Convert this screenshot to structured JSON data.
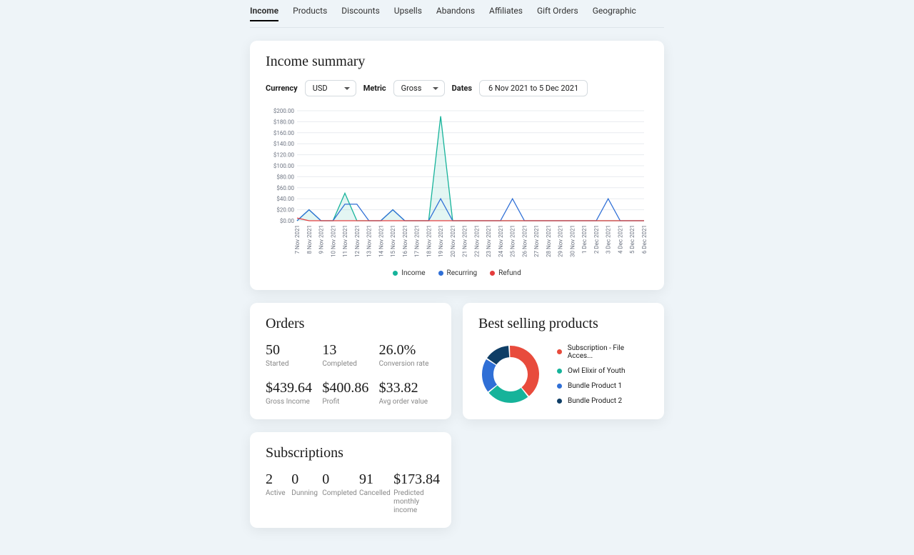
{
  "tabs": [
    "Income",
    "Products",
    "Discounts",
    "Upsells",
    "Abandons",
    "Affiliates",
    "Gift Orders",
    "Geographic"
  ],
  "active_tab_index": 0,
  "income_summary": {
    "title": "Income summary",
    "currency_label": "Currency",
    "currency_value": "USD",
    "metric_label": "Metric",
    "metric_value": "Gross",
    "dates_label": "Dates",
    "dates_value": "6 Nov 2021 to 5 Dec 2021",
    "legend": {
      "income": "Income",
      "recurring": "Recurring",
      "refund": "Refund"
    }
  },
  "chart_data": {
    "type": "line",
    "xlabel": "",
    "ylabel": "",
    "ylim": [
      0,
      200
    ],
    "ytick_labels": [
      "$0.00",
      "$20.00",
      "$40.00",
      "$60.00",
      "$80.00",
      "$100.00",
      "$120.00",
      "$140.00",
      "$160.00",
      "$180.00",
      "$200.00"
    ],
    "categories": [
      "7 Nov 2021",
      "8 Nov 2021",
      "9 Nov 2021",
      "10 Nov 2021",
      "11 Nov 2021",
      "12 Nov 2021",
      "13 Nov 2021",
      "14 Nov 2021",
      "15 Nov 2021",
      "16 Nov 2021",
      "17 Nov 2021",
      "18 Nov 2021",
      "19 Nov 2021",
      "20 Nov 2021",
      "21 Nov 2021",
      "22 Nov 2021",
      "23 Nov 2021",
      "24 Nov 2021",
      "25 Nov 2021",
      "26 Nov 2021",
      "27 Nov 2021",
      "28 Nov 2021",
      "29 Nov 2021",
      "30 Nov 2021",
      "1 Dec 2021",
      "2 Dec 2021",
      "3 Dec 2021",
      "4 Dec 2021",
      "5 Dec 2021",
      "6 Dec 2021"
    ],
    "series": [
      {
        "name": "Income",
        "color": "#16b39a",
        "fill": "rgba(22,179,154,0.12)",
        "values": [
          0,
          20,
          0,
          0,
          50,
          0,
          0,
          0,
          20,
          0,
          0,
          0,
          190,
          0,
          0,
          0,
          0,
          0,
          0,
          0,
          0,
          0,
          0,
          0,
          0,
          0,
          0,
          0,
          0,
          0
        ]
      },
      {
        "name": "Recurring",
        "color": "#2f6fd6",
        "values": [
          0,
          20,
          0,
          0,
          30,
          30,
          0,
          0,
          20,
          0,
          0,
          0,
          40,
          0,
          0,
          0,
          0,
          0,
          40,
          0,
          0,
          0,
          0,
          0,
          0,
          0,
          40,
          0,
          0,
          0
        ]
      },
      {
        "name": "Refund",
        "color": "#e43d3d",
        "values": [
          5,
          0,
          0,
          0,
          0,
          0,
          0,
          0,
          0,
          0,
          0,
          0,
          0,
          0,
          0,
          0,
          0,
          0,
          0,
          0,
          0,
          0,
          0,
          0,
          0,
          0,
          0,
          0,
          0,
          0
        ]
      }
    ]
  },
  "orders": {
    "title": "Orders",
    "started_val": "50",
    "started_lbl": "Started",
    "completed_val": "13",
    "completed_lbl": "Completed",
    "conv_val": "26.0%",
    "conv_lbl": "Conversion rate",
    "gross_val": "$439.64",
    "gross_lbl": "Gross Income",
    "profit_val": "$400.86",
    "profit_lbl": "Profit",
    "avg_val": "$33.82",
    "avg_lbl": "Avg order value"
  },
  "best_selling": {
    "title": "Best selling products",
    "items": [
      {
        "label": "Subscription - File Acces...",
        "color": "#e84b3c",
        "value": 40
      },
      {
        "label": "Owl Elixir of Youth",
        "color": "#16b39a",
        "value": 25
      },
      {
        "label": "Bundle Product 1",
        "color": "#2f6fd6",
        "value": 20
      },
      {
        "label": "Bundle Product 2",
        "color": "#0f3e66",
        "value": 15
      }
    ]
  },
  "subscriptions": {
    "title": "Subscriptions",
    "active_val": "2",
    "active_lbl": "Active",
    "dunning_val": "0",
    "dunning_lbl": "Dunning",
    "completed_val": "0",
    "completed_lbl": "Completed",
    "cancelled_val": "91",
    "cancelled_lbl": "Cancelled",
    "predicted_val": "$173.84",
    "predicted_lbl": "Predicted monthly income"
  }
}
